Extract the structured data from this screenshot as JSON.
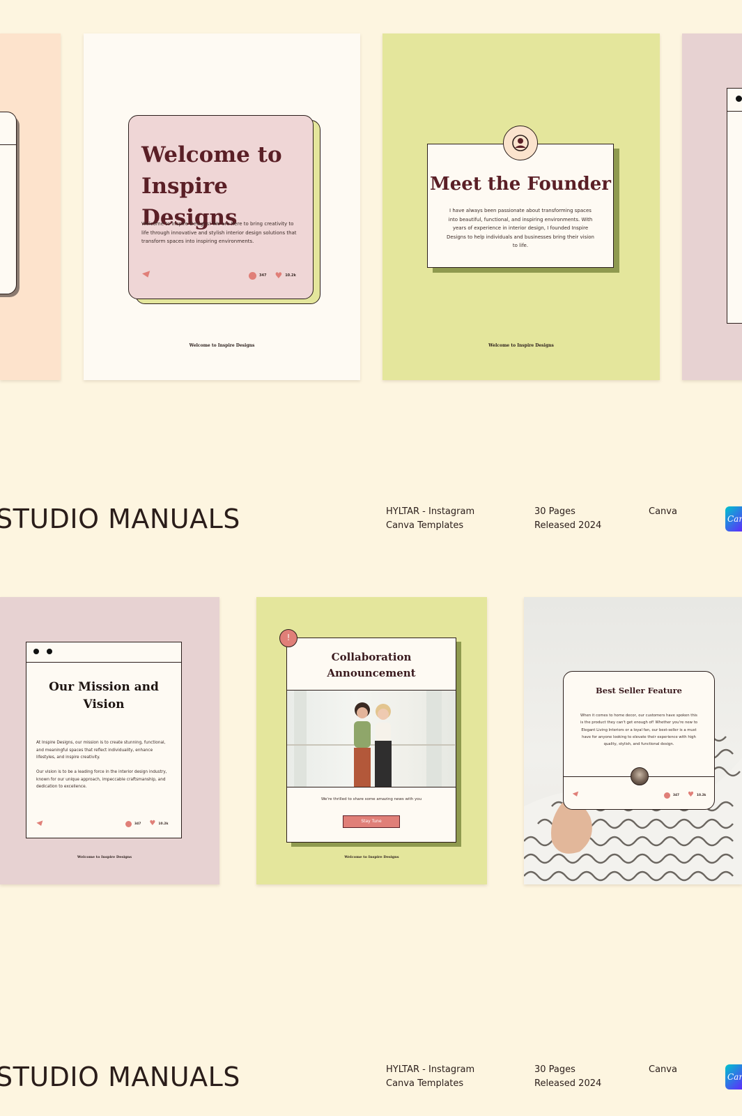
{
  "colors": {
    "background": "#fdf5e0",
    "peach": "#fde3cc",
    "cream": "#fefaf3",
    "lime": "#e4e69c",
    "mauve": "#e7d2d2",
    "pink_card": "#efd6d6",
    "maroon": "#5a1f26",
    "coral": "#e07f78"
  },
  "row1": {
    "welcome": {
      "title_line1": "Welcome to",
      "title_line2": "Inspire Designs",
      "body": "Welcome to Inspire Designs! We are here to bring creativity to life through innovative and stylish interior design solutions that transform spaces into inspiring environments.",
      "comments": "347",
      "likes": "10.2k",
      "footer": "Welcome to Inspire Designs"
    },
    "founder": {
      "title": "Meet the Founder",
      "body": "I have always been passionate about transforming spaces into beautiful, functional, and inspiring environments. With years of experience in interior design, I founded Inspire Designs to help individuals and businesses bring their vision to life.",
      "footer": "Welcome to Inspire Designs"
    }
  },
  "info_bar_1": {
    "brand": "STUDIO MANUALS",
    "product_line1": "HYLTAR - Instagram",
    "product_line2": "Canva Templates",
    "pages": "30 Pages",
    "released": "Released 2024",
    "platform": "Canva",
    "badge": "Canva"
  },
  "row2": {
    "mission": {
      "title_line1": "Our Mission and",
      "title_line2": "Vision",
      "body1": "At Inspire Designs, our mission is to create stunning, functional, and meaningful spaces that reflect individuality, enhance lifestyles, and inspire creativity.",
      "body2": "Our vision is to be a leading force in the interior design industry, known for our unique approach, impeccable craftsmanship, and dedication to excellence.",
      "comments": "347",
      "likes": "10.2k",
      "footer": "Welcome to Inspire Designs"
    },
    "collab": {
      "title_line1": "Collaboration",
      "title_line2": "Announcement",
      "caption": "We're thrilled to share some amazing news with you",
      "button": "Stay Tune",
      "footer": "Welcome to Inspire Designs"
    },
    "bestseller": {
      "title": "Best Seller Feature",
      "body": "When it comes to home decor, our customers have spoken this is the product they can't get enough of! Whether you're new to Elegant Living Interiors or a loyal fan, our best-seller is a must have for anyone looking to elevate their experience with high quality, stylish, and functional design.",
      "comments": "347",
      "likes": "10.2k"
    }
  },
  "info_bar_2": {
    "brand": "STUDIO MANUALS",
    "product_line1": "HYLTAR - Instagram",
    "product_line2": "Canva Templates",
    "pages": "30 Pages",
    "released": "Released 2024",
    "platform": "Canva",
    "badge": "Canva"
  }
}
